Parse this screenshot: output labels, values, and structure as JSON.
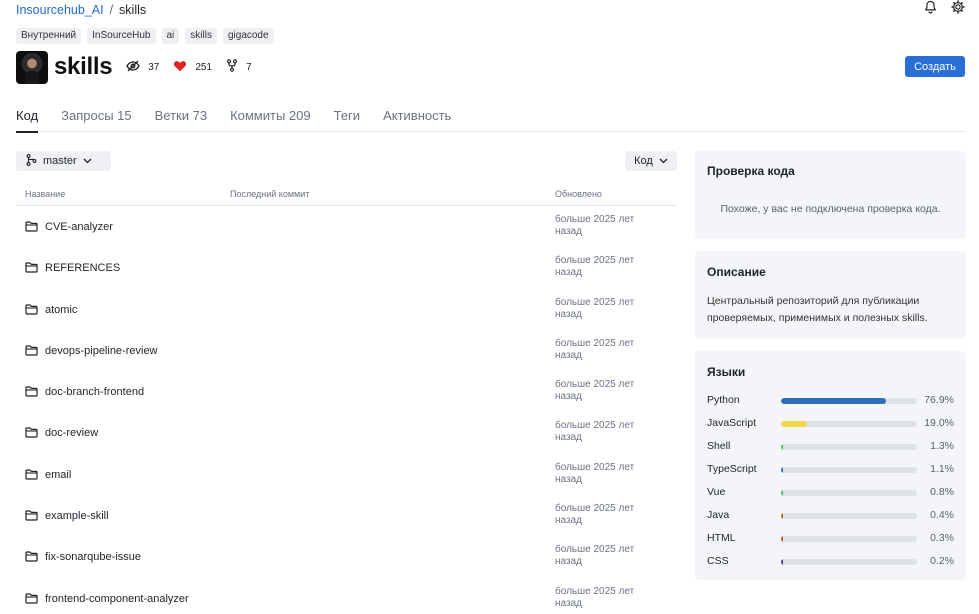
{
  "breadcrumb": {
    "owner": "Insourcehub_AI",
    "separator": "/",
    "repo": "skills"
  },
  "tags": [
    "Внутренний",
    "InSourceHub",
    "ai",
    "skills",
    "gigacode"
  ],
  "repo": {
    "name": "skills",
    "watchers": "37",
    "likes": "251",
    "forks": "7",
    "create_label": "Создать"
  },
  "tabs": [
    {
      "label": "Код",
      "active": true
    },
    {
      "label": "Запросы 15"
    },
    {
      "label": "Ветки 73"
    },
    {
      "label": "Коммиты 209"
    },
    {
      "label": "Теги"
    },
    {
      "label": "Активность"
    }
  ],
  "branch": {
    "label": "master"
  },
  "code_button": {
    "label": "Код"
  },
  "files": {
    "columns": {
      "name": "Название",
      "last_commit": "Последний коммит",
      "updated": "Обновлено"
    },
    "rows": [
      {
        "name": "CVE-analyzer",
        "updated": "больше 2025 лет назад"
      },
      {
        "name": "REFERENCES",
        "updated": "больше 2025 лет назад"
      },
      {
        "name": "atomic",
        "updated": "больше 2025 лет назад"
      },
      {
        "name": "devops-pipeline-review",
        "updated": "больше 2025 лет назад"
      },
      {
        "name": "doc-branch-frontend",
        "updated": "больше 2025 лет назад"
      },
      {
        "name": "doc-review",
        "updated": "больше 2025 лет назад"
      },
      {
        "name": "email",
        "updated": "больше 2025 лет назад"
      },
      {
        "name": "example-skill",
        "updated": "больше 2025 лет назад"
      },
      {
        "name": "fix-sonarqube-issue",
        "updated": "больше 2025 лет назад"
      },
      {
        "name": "frontend-component-analyzer",
        "updated": "больше 2025 лет назад"
      }
    ]
  },
  "code_review": {
    "title": "Проверка кода",
    "message": "Похоже, у вас не подключена проверка кода."
  },
  "description": {
    "title": "Описание",
    "text": "Центральный репозиторий для публикации проверяемых, применимых и полезных skills."
  },
  "languages": {
    "title": "Языки",
    "items": [
      {
        "name": "Python",
        "percent": "76.9%",
        "value": 76.9,
        "color": "#2f6db5"
      },
      {
        "name": "JavaScript",
        "percent": "19.0%",
        "value": 19.0,
        "color": "#f1d84b"
      },
      {
        "name": "Shell",
        "percent": "1.3%",
        "value": 1.3,
        "color": "#4cc35a"
      },
      {
        "name": "TypeScript",
        "percent": "1.1%",
        "value": 1.1,
        "color": "#2f6db5"
      },
      {
        "name": "Vue",
        "percent": "0.8%",
        "value": 0.8,
        "color": "#41b883"
      },
      {
        "name": "Java",
        "percent": "0.4%",
        "value": 0.4,
        "color": "#b07219"
      },
      {
        "name": "HTML",
        "percent": "0.3%",
        "value": 0.3,
        "color": "#e34c26"
      },
      {
        "name": "CSS",
        "percent": "0.2%",
        "value": 0.2,
        "color": "#563d7c"
      }
    ]
  },
  "colors": {
    "accent": "#2a6fd6",
    "like": "#e02424",
    "link": "#2368c6"
  }
}
